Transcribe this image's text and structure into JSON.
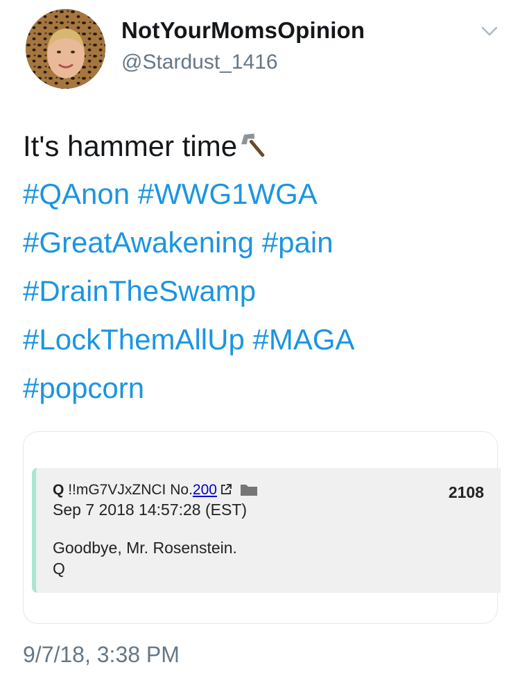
{
  "tweet": {
    "display_name": "NotYourMomsOpinion",
    "handle": "@Stardust_1416",
    "text_first": "It's hammer time",
    "hashtag_lines": [
      [
        "#QAnon",
        "#WWG1WGA"
      ],
      [
        "#GreatAwakening",
        "#pain"
      ],
      [
        "#DrainTheSwamp"
      ],
      [
        "#LockThemAllUp",
        "#MAGA"
      ],
      [
        "#popcorn"
      ]
    ],
    "timestamp": "9/7/18, 3:38 PM",
    "emoji_icon": "hammer-icon",
    "menu_icon": "chevron-down-icon",
    "link_color": "#1b95e0"
  },
  "embedded_post": {
    "author": "Q",
    "tripcode": "!!mG7VJxZNCI",
    "post_no_prefix": "No.",
    "post_no": "200",
    "date": "Sep 7 2018 14:57:28 (EST)",
    "count": "2108",
    "body_lines": [
      "Goodbye, Mr. Rosenstein.",
      "Q"
    ],
    "accent_color": "#a8e6cf"
  }
}
